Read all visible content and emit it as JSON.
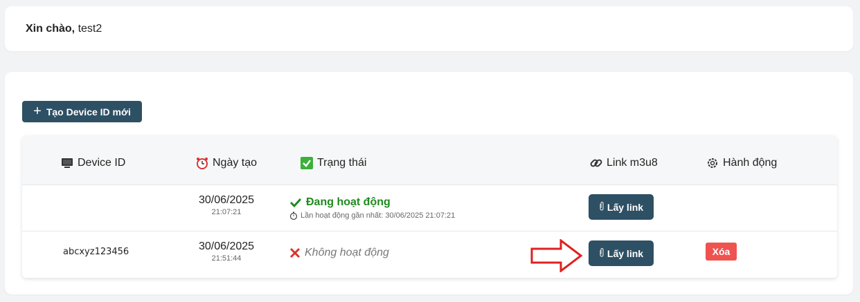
{
  "greeting": {
    "prefix": "Xin chào,",
    "user": "test2"
  },
  "create_button": {
    "label": "Tạo Device ID mới",
    "icon": "plus-icon"
  },
  "table": {
    "headers": {
      "device_id": "Device ID",
      "created": "Ngày tạo",
      "status": "Trạng thái",
      "link": "Link m3u8",
      "action": "Hành động"
    },
    "rows": [
      {
        "device_id": "",
        "date": "30/06/2025",
        "time": "21:07:21",
        "status": "Đang hoạt động",
        "last_active": "Lần hoạt động gần nhất: 30/06/2025 21:07:21",
        "link_label": "Lấy link"
      },
      {
        "device_id": "abcxyz123456",
        "date": "30/06/2025",
        "time": "21:51:44",
        "status": "Không hoạt động",
        "link_label": "Lấy link",
        "delete_label": "Xóa"
      }
    ]
  },
  "colors": {
    "primary": "#2e5064",
    "active": "#1f8a1f",
    "danger": "#ef5350",
    "arrow": "#e02020"
  }
}
